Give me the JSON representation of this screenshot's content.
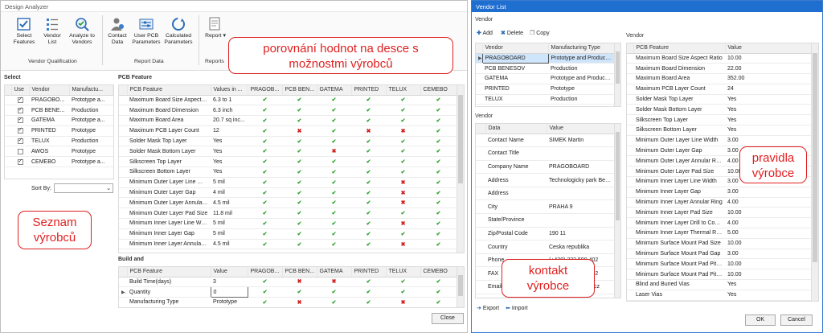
{
  "design_analyzer": {
    "title": "Design Analyzer",
    "ribbon": {
      "buttons": [
        {
          "label": "Select Features"
        },
        {
          "label": "Vendor List"
        },
        {
          "label": "Analyze to Vendors"
        },
        {
          "label": "Contact Data"
        },
        {
          "label": "User PCB Parameters"
        },
        {
          "label": "Calculated Parameters"
        },
        {
          "label": "Report"
        }
      ],
      "groups": [
        "Vendor Qualification",
        "Report Data",
        "Reports"
      ]
    },
    "select": {
      "title": "Select",
      "columns": [
        "Use",
        "Vendor",
        "Manufactu..."
      ],
      "rows": [
        {
          "use": true,
          "vendor": "PRAGOBO...",
          "type": "Prototype a..."
        },
        {
          "use": true,
          "vendor": "PCB BENE...",
          "type": "Production"
        },
        {
          "use": true,
          "vendor": "GATEMA",
          "type": "Prototype a..."
        },
        {
          "use": true,
          "vendor": "PRINTED",
          "type": "Prototype"
        },
        {
          "use": true,
          "vendor": "TELUX",
          "type": "Production"
        },
        {
          "use": false,
          "vendor": "AWOS",
          "type": "Prototype"
        },
        {
          "use": true,
          "vendor": "CEMEBO",
          "type": "Prototype a..."
        }
      ],
      "sort_label": "Sort By:"
    },
    "pcb_feature": {
      "title": "PCB Feature",
      "columns": [
        "PCB Feature",
        "Values in ...",
        "PRAGOB...",
        "PCB BEN...",
        "GATEMA",
        "PRINTED",
        "TELUX",
        "CEMEBO"
      ],
      "rows": [
        {
          "feature": "Maximum Board Size Aspect Ratio",
          "value": "6.3 to 1",
          "marks": [
            "ok",
            "ok",
            "ok",
            "ok",
            "ok",
            "ok"
          ]
        },
        {
          "feature": "Maximum Board Dimension",
          "value": "6.3 inch",
          "marks": [
            "ok",
            "ok",
            "ok",
            "ok",
            "ok",
            "ok"
          ]
        },
        {
          "feature": "Maximum Board Area",
          "value": "20.7 sq inc...",
          "marks": [
            "ok",
            "ok",
            "ok",
            "ok",
            "ok",
            "ok"
          ]
        },
        {
          "feature": "Maximum PCB Layer Count",
          "value": "12",
          "marks": [
            "ok",
            "no",
            "ok",
            "no",
            "no",
            "ok"
          ]
        },
        {
          "feature": "Solder Mask Top Layer",
          "value": "Yes",
          "marks": [
            "ok",
            "ok",
            "ok",
            "ok",
            "ok",
            "ok"
          ]
        },
        {
          "feature": "Solder Mask Bottom Layer",
          "value": "Yes",
          "marks": [
            "ok",
            "ok",
            "no",
            "ok",
            "ok",
            "ok"
          ]
        },
        {
          "feature": "Silkscreen Top Layer",
          "value": "Yes",
          "marks": [
            "ok",
            "ok",
            "ok",
            "ok",
            "ok",
            "ok"
          ]
        },
        {
          "feature": "Silkscreen Bottom Layer",
          "value": "Yes",
          "marks": [
            "ok",
            "ok",
            "ok",
            "ok",
            "ok",
            "ok"
          ]
        },
        {
          "feature": "Minimum Outer Layer Line Width",
          "value": "5 mil",
          "marks": [
            "ok",
            "ok",
            "ok",
            "ok",
            "no",
            "ok"
          ]
        },
        {
          "feature": "Minimum Outer Layer Gap",
          "value": "4 mil",
          "marks": [
            "ok",
            "ok",
            "ok",
            "ok",
            "no",
            "ok"
          ]
        },
        {
          "feature": "Minimum Outer Layer Annular Ring",
          "value": "4.5 mil",
          "marks": [
            "ok",
            "ok",
            "ok",
            "ok",
            "no",
            "ok"
          ]
        },
        {
          "feature": "Minimum Outer Layer Pad Size",
          "value": "11.8 mil",
          "marks": [
            "ok",
            "ok",
            "ok",
            "ok",
            "ok",
            "ok"
          ]
        },
        {
          "feature": "Minimum Inner Layer Line Width",
          "value": "5 mil",
          "marks": [
            "ok",
            "ok",
            "ok",
            "ok",
            "no",
            "ok"
          ]
        },
        {
          "feature": "Minimum Inner Layer Gap",
          "value": "5 mil",
          "marks": [
            "ok",
            "ok",
            "ok",
            "ok",
            "ok",
            "ok"
          ]
        },
        {
          "feature": "Minimum Inner Layer Annular Ring",
          "value": "4.5 mil",
          "marks": [
            "ok",
            "ok",
            "ok",
            "ok",
            "no",
            "ok"
          ]
        }
      ]
    },
    "build_and": {
      "title": "Build and",
      "columns": [
        "PCB Feature",
        "Value",
        "PRAGOB...",
        "PCB BEN...",
        "GATEMA",
        "PRINTED",
        "TELUX",
        "CEMEBO"
      ],
      "rows": [
        {
          "feature": "Build Time(days)",
          "value": "3",
          "marks": [
            "ok",
            "no",
            "no",
            "ok",
            "ok",
            "ok"
          ]
        },
        {
          "feature": "Quantity",
          "value": "0",
          "marks": [
            "ok",
            "ok",
            "ok",
            "ok",
            "ok",
            "ok"
          ]
        },
        {
          "feature": "Manufacturing Type",
          "value": "Prototype",
          "marks": [
            "ok",
            "no",
            "ok",
            "ok",
            "no",
            "ok"
          ]
        }
      ]
    },
    "close_label": "Close"
  },
  "callouts": {
    "compare": "porovnání hodnot na desce s možnostmi výrobců",
    "list": "Seznam výrobců",
    "contact": "kontakt výrobce",
    "rules": "pravidla výrobce"
  },
  "vendor_list": {
    "title": "Vendor List",
    "vendor_section": "Vendor",
    "toolbar": {
      "add": "Add",
      "delete": "Delete",
      "copy": "Copy"
    },
    "vendors": {
      "columns": [
        "Vendor",
        "Manufacturing Type"
      ],
      "rows": [
        {
          "vendor": "PRAGOBOARD",
          "type": "Prototype and Production"
        },
        {
          "vendor": "PCB BENESOV",
          "type": "Production"
        },
        {
          "vendor": "GATEMA",
          "type": "Prototype and Production"
        },
        {
          "vendor": "PRINTED",
          "type": "Prototype"
        },
        {
          "vendor": "TELUX",
          "type": "Production"
        }
      ]
    },
    "contact": {
      "title": "Vendor",
      "columns": [
        "Data",
        "Value"
      ],
      "rows": [
        {
          "k": "Contact Name",
          "v": "SIMEK Martin"
        },
        {
          "k": "Contact Title",
          "v": ""
        },
        {
          "k": "Company Name",
          "v": "PRAGOBOARD"
        },
        {
          "k": "Address",
          "v": "Technologicky park Bech..."
        },
        {
          "k": "Address",
          "v": ""
        },
        {
          "k": "City",
          "v": "PRAHA 9"
        },
        {
          "k": "State/Province",
          "v": ""
        },
        {
          "k": "Zip/Postal Code",
          "v": "190 11"
        },
        {
          "k": "Country",
          "v": "Ceska republika"
        },
        {
          "k": "Phone",
          "v": "(+420) 222 590 402"
        },
        {
          "k": "FAX",
          "v": "(+420) 222 724 032"
        },
        {
          "k": "Email",
          "v": "pcb@pragoboard.cz"
        }
      ]
    },
    "rules": {
      "title": "Vendor",
      "columns": [
        "PCB Feature",
        "Value"
      ],
      "rows": [
        {
          "k": "Maximum Board Size Aspect Ratio",
          "v": "10.00"
        },
        {
          "k": "Maximum Board Dimension",
          "v": "22.00"
        },
        {
          "k": "Maximum Board Area",
          "v": "352.00"
        },
        {
          "k": "Maximum PCB Layer Count",
          "v": "24"
        },
        {
          "k": "Solder Mask Top Layer",
          "v": "Yes"
        },
        {
          "k": "Solder Mask Bottom Layer",
          "v": "Yes"
        },
        {
          "k": "Silkscreen Top Layer",
          "v": "Yes"
        },
        {
          "k": "Silkscreen Bottom Layer",
          "v": "Yes"
        },
        {
          "k": "Minimum Outer Layer Line Width",
          "v": "3.00"
        },
        {
          "k": "Minimum Outer Layer Gap",
          "v": "3.00"
        },
        {
          "k": "Minimum Outer Layer Annular Ring",
          "v": "4.00"
        },
        {
          "k": "Minimum Outer Layer Pad Size",
          "v": "10.00"
        },
        {
          "k": "Minimum Inner Layer Line Width",
          "v": "3.00"
        },
        {
          "k": "Minimum Inner Layer Gap",
          "v": "3.00"
        },
        {
          "k": "Minimum Inner Layer Annular Ring",
          "v": "4.00"
        },
        {
          "k": "Minimum Inner Layer Pad Size",
          "v": "10.00"
        },
        {
          "k": "Minimum Inner Layer Drill to Cop...",
          "v": "4.00"
        },
        {
          "k": "Minimum Inner Layer Thermal Re...",
          "v": "5.00"
        },
        {
          "k": "Minimum Surface Mount Pad Size",
          "v": "10.00"
        },
        {
          "k": "Minimum Surface Mount Pad Gap",
          "v": "3.00"
        },
        {
          "k": "Minimum Surface Mount Pad Pitc...",
          "v": "10.00"
        },
        {
          "k": "Minimum Surface Mount Pad Pitc...",
          "v": "10.00"
        },
        {
          "k": "Blind and Buried Vias",
          "v": "Yes"
        },
        {
          "k": "Laser Vias",
          "v": "Yes"
        }
      ]
    },
    "export": "Export",
    "import": "Import",
    "ok": "OK",
    "cancel": "Cancel"
  },
  "colors": {
    "ok": "#2ea02e",
    "no": "#d32020",
    "callout": "#e02020",
    "titlebar": "#1f6fd1"
  }
}
